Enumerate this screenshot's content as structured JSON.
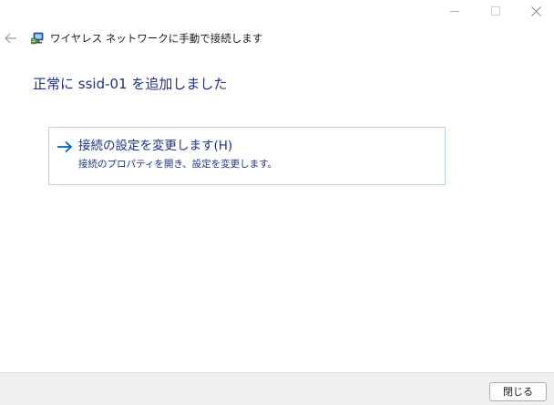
{
  "window": {
    "caption_buttons": {
      "minimize_icon": "minimize-icon",
      "maximize_icon": "maximize-icon",
      "close_icon": "close-icon"
    }
  },
  "header": {
    "back_icon": "back-arrow-icon",
    "wizard_icon": "network-wizard-icon",
    "title": "ワイヤレス ネットワークに手動で接続します"
  },
  "main": {
    "heading": "正常に ssid-01 を追加しました",
    "command_link": {
      "arrow_icon": "right-arrow-icon",
      "title": "接続の設定を変更します(H)",
      "description": "接続のプロパティを開き、設定を変更します。"
    }
  },
  "footer": {
    "close_label": "閉じる"
  },
  "colors": {
    "heading": "#1e3287",
    "link_arrow": "#0067c0",
    "link_border": "#b9d1ea",
    "footer_bg": "#f0f0f0"
  }
}
